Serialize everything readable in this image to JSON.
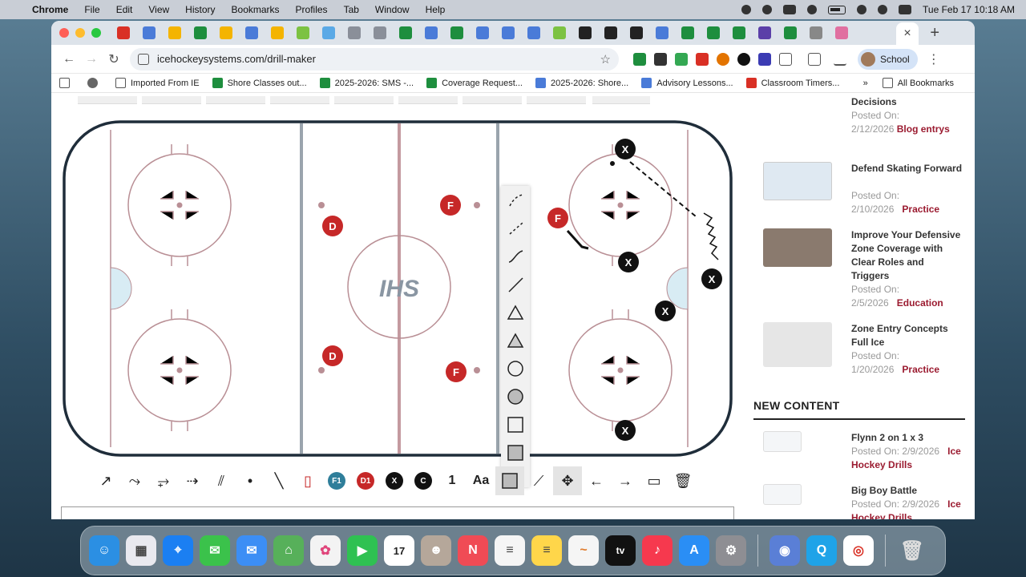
{
  "menubar": {
    "app": "Chrome",
    "menus": [
      "File",
      "Edit",
      "View",
      "History",
      "Bookmarks",
      "Profiles",
      "Tab",
      "Window",
      "Help"
    ],
    "datetime": "Tue Feb 17  10:18 AM"
  },
  "browser": {
    "url": "icehockeysystems.com/drill-maker",
    "profile_label": "School",
    "tab_close": "×",
    "new_tab": "+"
  },
  "bookmarks": [
    {
      "label": "Imported From IE",
      "color": "#555555"
    },
    {
      "label": "Shore Classes out...",
      "color": "#1e8e3e"
    },
    {
      "label": "2025-2026: SMS -...",
      "color": "#1e8e3e"
    },
    {
      "label": "Coverage Request...",
      "color": "#1e8e3e"
    },
    {
      "label": "2025-2026: Shore...",
      "color": "#4a7bd8"
    },
    {
      "label": "Advisory Lessons...",
      "color": "#4a7bd8"
    },
    {
      "label": "Classroom Timers...",
      "color": "#d93025"
    }
  ],
  "bookmarks_right": {
    "chevron": "»",
    "all": "All Bookmarks"
  },
  "rink": {
    "center_logo": "IHS",
    "players": [
      {
        "label": "D",
        "type": "red"
      },
      {
        "label": "D",
        "type": "red"
      },
      {
        "label": "F",
        "type": "red"
      },
      {
        "label": "F",
        "type": "red"
      },
      {
        "label": "F",
        "type": "red"
      },
      {
        "label": "X",
        "type": "black"
      },
      {
        "label": "X",
        "type": "black"
      },
      {
        "label": "X",
        "type": "black"
      },
      {
        "label": "X",
        "type": "black"
      },
      {
        "label": "X",
        "type": "black"
      }
    ]
  },
  "tools": {
    "f1": "F1",
    "d1": "D1",
    "x": "X",
    "c": "C",
    "number": "1",
    "text": "Aa"
  },
  "sidebar": {
    "posts": [
      {
        "title": "Decisions",
        "posted_label": "Posted On:",
        "date": "2/12/2026",
        "category": "Blog entrys"
      },
      {
        "title": "Defend Skating Forward",
        "posted_label": "Posted On:",
        "date": "2/10/2026",
        "category": "Practice"
      },
      {
        "title": "Improve Your Defensive Zone Coverage with Clear Roles and Triggers",
        "posted_label": "Posted On:",
        "date": "2/5/2026",
        "category": "Education"
      },
      {
        "title": "Zone Entry Concepts Full Ice",
        "posted_label": "Posted On:",
        "date": "1/20/2026",
        "category": "Practice"
      }
    ],
    "new_content_heading": "NEW CONTENT",
    "new_content": [
      {
        "title": "Flynn 2 on 1 x 3",
        "posted": "Posted On: 2/9/2026",
        "category": "Ice Hockey Drills"
      },
      {
        "title": "Big Boy Battle",
        "posted": "Posted On: 2/9/2026",
        "category": "Ice Hockey Drills"
      }
    ]
  },
  "colors": {
    "red_player": "#c62828",
    "rink_line": "#b98f95",
    "category": "#9b1b30"
  }
}
